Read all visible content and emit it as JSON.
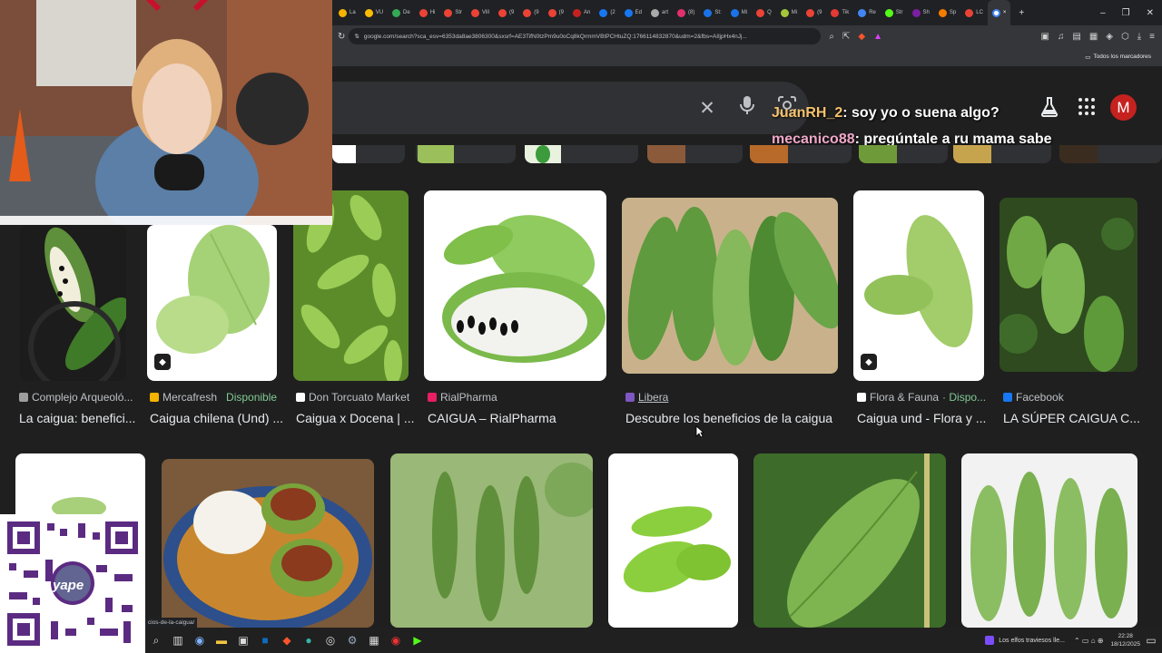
{
  "browser": {
    "tabs": [
      {
        "label": "La",
        "color": "#f4b400"
      },
      {
        "label": "VU",
        "color": "#fbbc04"
      },
      {
        "label": "De",
        "color": "#34a853"
      },
      {
        "label": "Hi",
        "color": "#ea4335"
      },
      {
        "label": "Str",
        "color": "#ea4335"
      },
      {
        "label": "Vill",
        "color": "#ea4335"
      },
      {
        "label": "(9",
        "color": "#ea4335"
      },
      {
        "label": "(9",
        "color": "#ea4335"
      },
      {
        "label": "(9",
        "color": "#ea4335"
      },
      {
        "label": "An",
        "color": "#c5221f"
      },
      {
        "label": "(2",
        "color": "#1877f2"
      },
      {
        "label": "Ed",
        "color": "#1877f2"
      },
      {
        "label": "art",
        "color": "#aaaaaa"
      },
      {
        "label": "(8)",
        "color": "#e1306c"
      },
      {
        "label": "St:",
        "color": "#1a73e8"
      },
      {
        "label": "Mi",
        "color": "#1a73e8"
      },
      {
        "label": "Q",
        "color": "#ea4335"
      },
      {
        "label": "Mi",
        "color": "#a4c639"
      },
      {
        "label": "(9",
        "color": "#ea4335"
      },
      {
        "label": "Tik",
        "color": "#e53935"
      },
      {
        "label": "Re",
        "color": "#4285f4"
      },
      {
        "label": "Str",
        "color": "#53fc18"
      },
      {
        "label": "Sh",
        "color": "#7b1fa2"
      },
      {
        "label": "Sp",
        "color": "#f57c00"
      },
      {
        "label": "LC",
        "color": "#ea4335"
      }
    ],
    "active_tab_close": "×",
    "new_tab": "+",
    "window_controls": {
      "minimize": "–",
      "maximize": "❐",
      "close": "✕"
    },
    "url": "google.com/search?sca_esv=6353da8ae3806300&sxsrf=AE3TifN0tzPm9u0oCq8kQrmmVBtPCHtuZQ:1766114832870&udm=2&fbs=AIljpHx4nJj...",
    "bookmarks_label": "Todos los marcadores"
  },
  "search": {
    "clear_icon": "✕",
    "mic_icon": "🎤",
    "lens_icon": "⌾",
    "avatar_letter": "M"
  },
  "chat": [
    {
      "user": "JuanRH_2",
      "message": ": soy yo o suena algo?"
    },
    {
      "user": "mecanico88",
      "message": ": pregúntale a ru mama sabe"
    }
  ],
  "results_row1": [
    {
      "source": "Complejo Arqueoló...",
      "available": "",
      "title": "La caigua: benefici...",
      "fav": "#9e9e9e"
    },
    {
      "source": "Mercafresh",
      "available": "Disponible",
      "title": "Caigua chilena (Und) ...",
      "fav": "#f4b400"
    },
    {
      "source": "Don Torcuato Market",
      "available": "",
      "title": "Caigua x Docena | ...",
      "fav": "#ffffff"
    },
    {
      "source": "RialPharma",
      "available": "",
      "title": "CAIGUA – RialPharma",
      "fav": "#e91e63"
    },
    {
      "source": "Libera",
      "available": "",
      "title": "Descubre los beneficios de la caigua",
      "fav": "#7e57c2"
    },
    {
      "source": "Flora & Fauna",
      "available": "· Dispo...",
      "title": "Caigua und - Flora y ...",
      "fav": "#ffffff"
    },
    {
      "source": "Facebook",
      "available": "",
      "title": "LA SÚPER CAIGUA C...",
      "fav": "#1877f2"
    }
  ],
  "qr": {
    "brand": "yape"
  },
  "taskbar": {
    "status_url": "cios-de-la-caigua/",
    "media_title": "Los elfos traviesos lle...",
    "time": "22:28",
    "date": "18/12/2025"
  }
}
